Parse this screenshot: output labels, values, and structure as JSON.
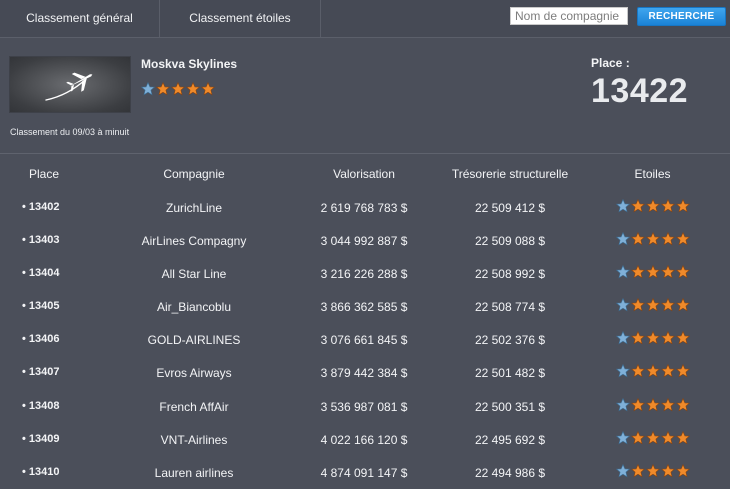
{
  "tabs": [
    {
      "label": "Classement général"
    },
    {
      "label": "Classement étoiles"
    }
  ],
  "search": {
    "placeholder": "Nom de compagnie",
    "button_label": "RECHERCHE"
  },
  "company": {
    "name": "Moskva Skylines",
    "stars": 4,
    "ranking_date": "Classement du 09/03 à minuit",
    "place_label": "Place :",
    "place_value": "13422"
  },
  "table": {
    "headers": [
      "Place",
      "Compagnie",
      "Valorisation",
      "Trésorerie structurelle",
      "Etoiles"
    ],
    "rows": [
      {
        "place": "• 13402",
        "company": "ZurichLine",
        "valuation": "2 619 768 783 $",
        "treasury": "22 509 412 $",
        "stars": 4
      },
      {
        "place": "• 13403",
        "company": "AirLines Compagny",
        "valuation": "3 044 992 887 $",
        "treasury": "22 509 088 $",
        "stars": 4
      },
      {
        "place": "• 13404",
        "company": "All Star Line",
        "valuation": "3 216 226 288 $",
        "treasury": "22 508 992 $",
        "stars": 4
      },
      {
        "place": "• 13405",
        "company": "Air_Biancoblu",
        "valuation": "3 866 362 585 $",
        "treasury": "22 508 774 $",
        "stars": 4
      },
      {
        "place": "• 13406",
        "company": "GOLD-AIRLINES",
        "valuation": "3 076 661 845 $",
        "treasury": "22 502 376 $",
        "stars": 4
      },
      {
        "place": "• 13407",
        "company": "Evros Airways",
        "valuation": "3 879 442 384 $",
        "treasury": "22 501 482 $",
        "stars": 4
      },
      {
        "place": "• 13408",
        "company": "French AffAir",
        "valuation": "3 536 987 081 $",
        "treasury": "22 500 351 $",
        "stars": 4
      },
      {
        "place": "• 13409",
        "company": "VNT-Airlines",
        "valuation": "4 022 166 120 $",
        "treasury": "22 495 692 $",
        "stars": 4
      },
      {
        "place": "• 13410",
        "company": "Lauren airlines",
        "valuation": "4 874 091 147 $",
        "treasury": "22 494 986 $",
        "stars": 4
      }
    ]
  },
  "colors": {
    "star_orange": "#f08a2a",
    "star_blue": "#7fb0d8",
    "accent_button": "#2a8fe0"
  }
}
